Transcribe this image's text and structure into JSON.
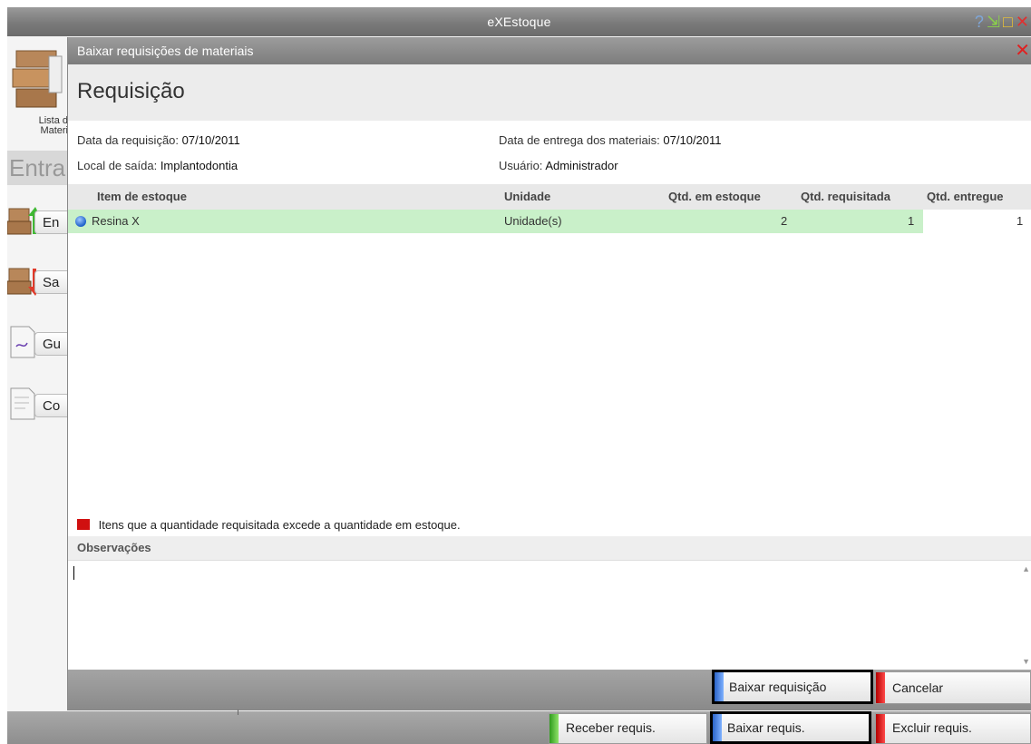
{
  "app": {
    "title": "eXEstoque",
    "window_controls": [
      "help-icon",
      "minimize-icon",
      "maximize-icon",
      "close-icon"
    ]
  },
  "background": {
    "lista_label_1": "Lista d",
    "lista_label_2": "Materi",
    "heading": "Entra",
    "side_buttons": [
      {
        "label": "En",
        "icon": "boxes-up-arrow-icon"
      },
      {
        "label": "Sa",
        "icon": "boxes-down-arrow-icon"
      },
      {
        "label": "Gu",
        "icon": "document-icon"
      },
      {
        "label": "Co",
        "icon": "document-icon"
      }
    ],
    "buttons": {
      "receber": "Receber requis.",
      "baixar": "Baixar requis.",
      "excluir": "Excluir requis."
    }
  },
  "dialog": {
    "title": "Baixar requisições de materiais",
    "header": "Requisição",
    "info": {
      "data_requisicao_label": "Data da requisição:",
      "data_requisicao_value": "07/10/2011",
      "data_entrega_label": "Data de entrega dos materiais:",
      "data_entrega_value": "07/10/2011",
      "local_saida_label": "Local de saída:",
      "local_saida_value": "Implantodontia",
      "usuario_label": "Usuário:",
      "usuario_value": "Administrador"
    },
    "table": {
      "columns": [
        "Item de estoque",
        "Unidade",
        "Qtd. em estoque",
        "Qtd. requisitada",
        "Qtd. entregue"
      ],
      "rows": [
        {
          "item": "Resina X",
          "unidade": "Unidade(s)",
          "qtd_estoque": "2",
          "qtd_requisitada": "1",
          "qtd_entregue": "1"
        }
      ]
    },
    "legend": "Itens que a quantidade requisitada excede a quantidade em estoque.",
    "observacoes_label": "Observações",
    "observacoes_value": "",
    "buttons": {
      "baixar": "Baixar requisição",
      "cancelar": "Cancelar"
    }
  },
  "colors": {
    "row_highlight": "#c9f0c9",
    "legend_red": "#d01010",
    "accent_blue": "#2a63c8",
    "accent_red": "#b30000",
    "accent_green": "#2f9b1c"
  }
}
